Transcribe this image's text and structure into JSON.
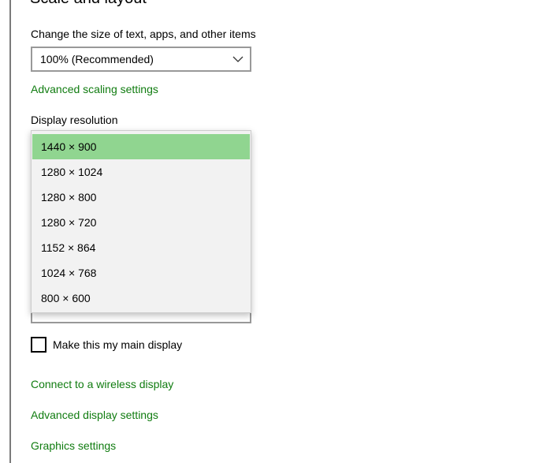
{
  "section": {
    "title": "Scale and layout"
  },
  "scale": {
    "label": "Change the size of text, apps, and other items",
    "selected_value": "100% (Recommended)",
    "advanced_link": "Advanced scaling settings"
  },
  "resolution": {
    "label": "Display resolution",
    "options": [
      {
        "label": "1440 × 900",
        "selected": true
      },
      {
        "label": "1280 × 1024",
        "selected": false
      },
      {
        "label": "1280 × 800",
        "selected": false
      },
      {
        "label": "1280 × 720",
        "selected": false
      },
      {
        "label": "1152 × 864",
        "selected": false
      },
      {
        "label": "1024 × 768",
        "selected": false
      },
      {
        "label": "800 × 600",
        "selected": false
      }
    ]
  },
  "main_display": {
    "checkbox_label": "Make this my main display",
    "checked": false
  },
  "links": {
    "wireless": "Connect to a wireless display",
    "advanced_display": "Advanced display settings",
    "graphics": "Graphics settings"
  },
  "colors": {
    "accent_link": "#107c10",
    "selected_option": "#90d590",
    "dropdown_bg": "#f2f2f2"
  }
}
